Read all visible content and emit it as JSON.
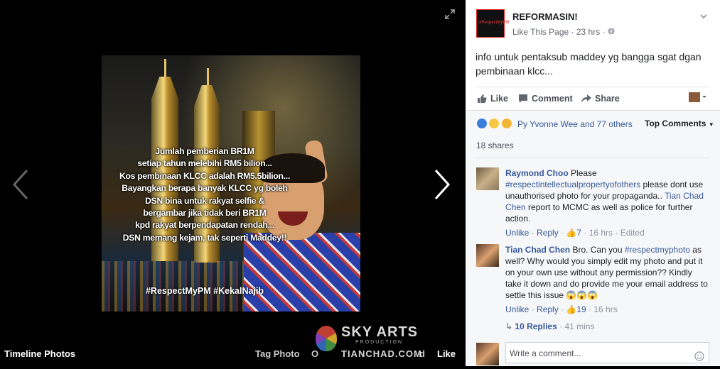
{
  "viewer": {
    "album_label": "Timeline Photos",
    "actions": [
      "Tag Photo",
      "O",
      "d",
      "Like"
    ],
    "overlay_lines": [
      "Jumlah pemberian BR1M",
      "setiap tahun melebihi RM5 bilion...",
      "Kos pembinaan KLCC adalah RM5.5bilion...",
      "Bayangkan berapa banyak KLCC yg boleh",
      "DSN bina untuk rakyat selfie &",
      "bergambar jika tidak beri BR1M",
      "kpd rakyat berpendapatan rendah...",
      "DSN memang kejam, tak seperti Maddey!!"
    ],
    "overlay_hashtags": "#RespectMyPM #KekalNajib",
    "watermark": {
      "title": "SKY ARTS",
      "sub": "PRODUCTION",
      "site": "TIANCHAD.COM"
    },
    "avatar_caption": "#RespectMyPM"
  },
  "post": {
    "page_name": "REFORMASIN!",
    "like_link": "Like This Page",
    "time": "23 hrs",
    "text": "info untuk pentaksub maddey yg bangga sgat dgan pembinaan klcc...",
    "actions": {
      "like": "Like",
      "comment": "Comment",
      "share": "Share"
    }
  },
  "feedback": {
    "reactions_text": "Py Yvonne Wee and 77 others",
    "sort": "Top Comments",
    "shares": "18 shares",
    "comments": [
      {
        "name": "Raymond Choo",
        "text_a": "Please",
        "tag": "#respectintellectualpropertyofothers",
        "text_b": "please dont use unauthorised photo for your propaganda..",
        "mention": "Tian Chad Chen",
        "text_c": "report to MCMC as well as police for further action.",
        "unlike": "Unlike",
        "reply": "Reply",
        "likes": "7",
        "time": "16 hrs",
        "edited": "Edited"
      },
      {
        "name": "Tian Chad Chen",
        "text_a": "Bro. Can you",
        "tag": "#respectmyphoto",
        "text_b": "as well? Why would you simply edit my photo and put it on your own use without any permission?? Kindly take it down and do provide me your email address to settle this issue 😱😱😱",
        "unlike": "Unlike",
        "reply": "Reply",
        "likes": "19",
        "time": "16 hrs"
      }
    ],
    "replies": "10 Replies",
    "replies_time": "41 mins",
    "write_placeholder": "Write a comment..."
  }
}
